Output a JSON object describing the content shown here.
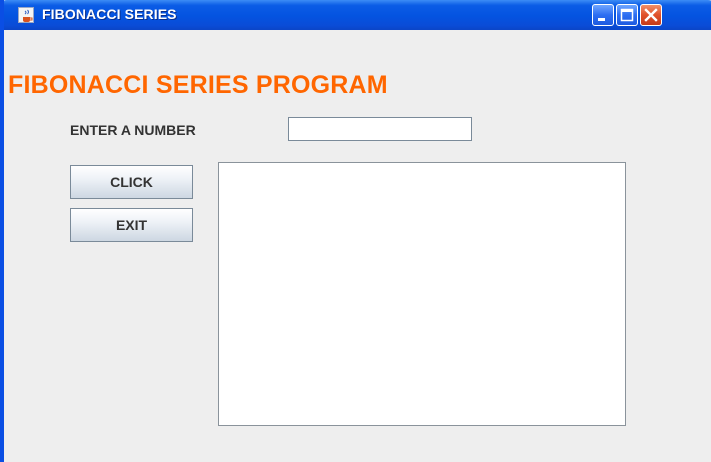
{
  "window": {
    "title": "FIBONACCI SERIES",
    "buttons": [
      "minimize",
      "maximize",
      "close"
    ],
    "colors": {
      "titlebar": "#0453e0",
      "background": "#eeeeee"
    }
  },
  "main": {
    "heading": "FIBONACCI SERIES PROGRAM",
    "heading_color": "#ff6600",
    "input_label": "ENTER A NUMBER",
    "input_value": "",
    "click_label": "CLICK",
    "exit_label": "EXIT",
    "output_text": ""
  },
  "icons": {
    "app": "java-cup-icon",
    "minimize": "minimize-icon",
    "maximize": "maximize-icon",
    "close": "close-icon"
  }
}
